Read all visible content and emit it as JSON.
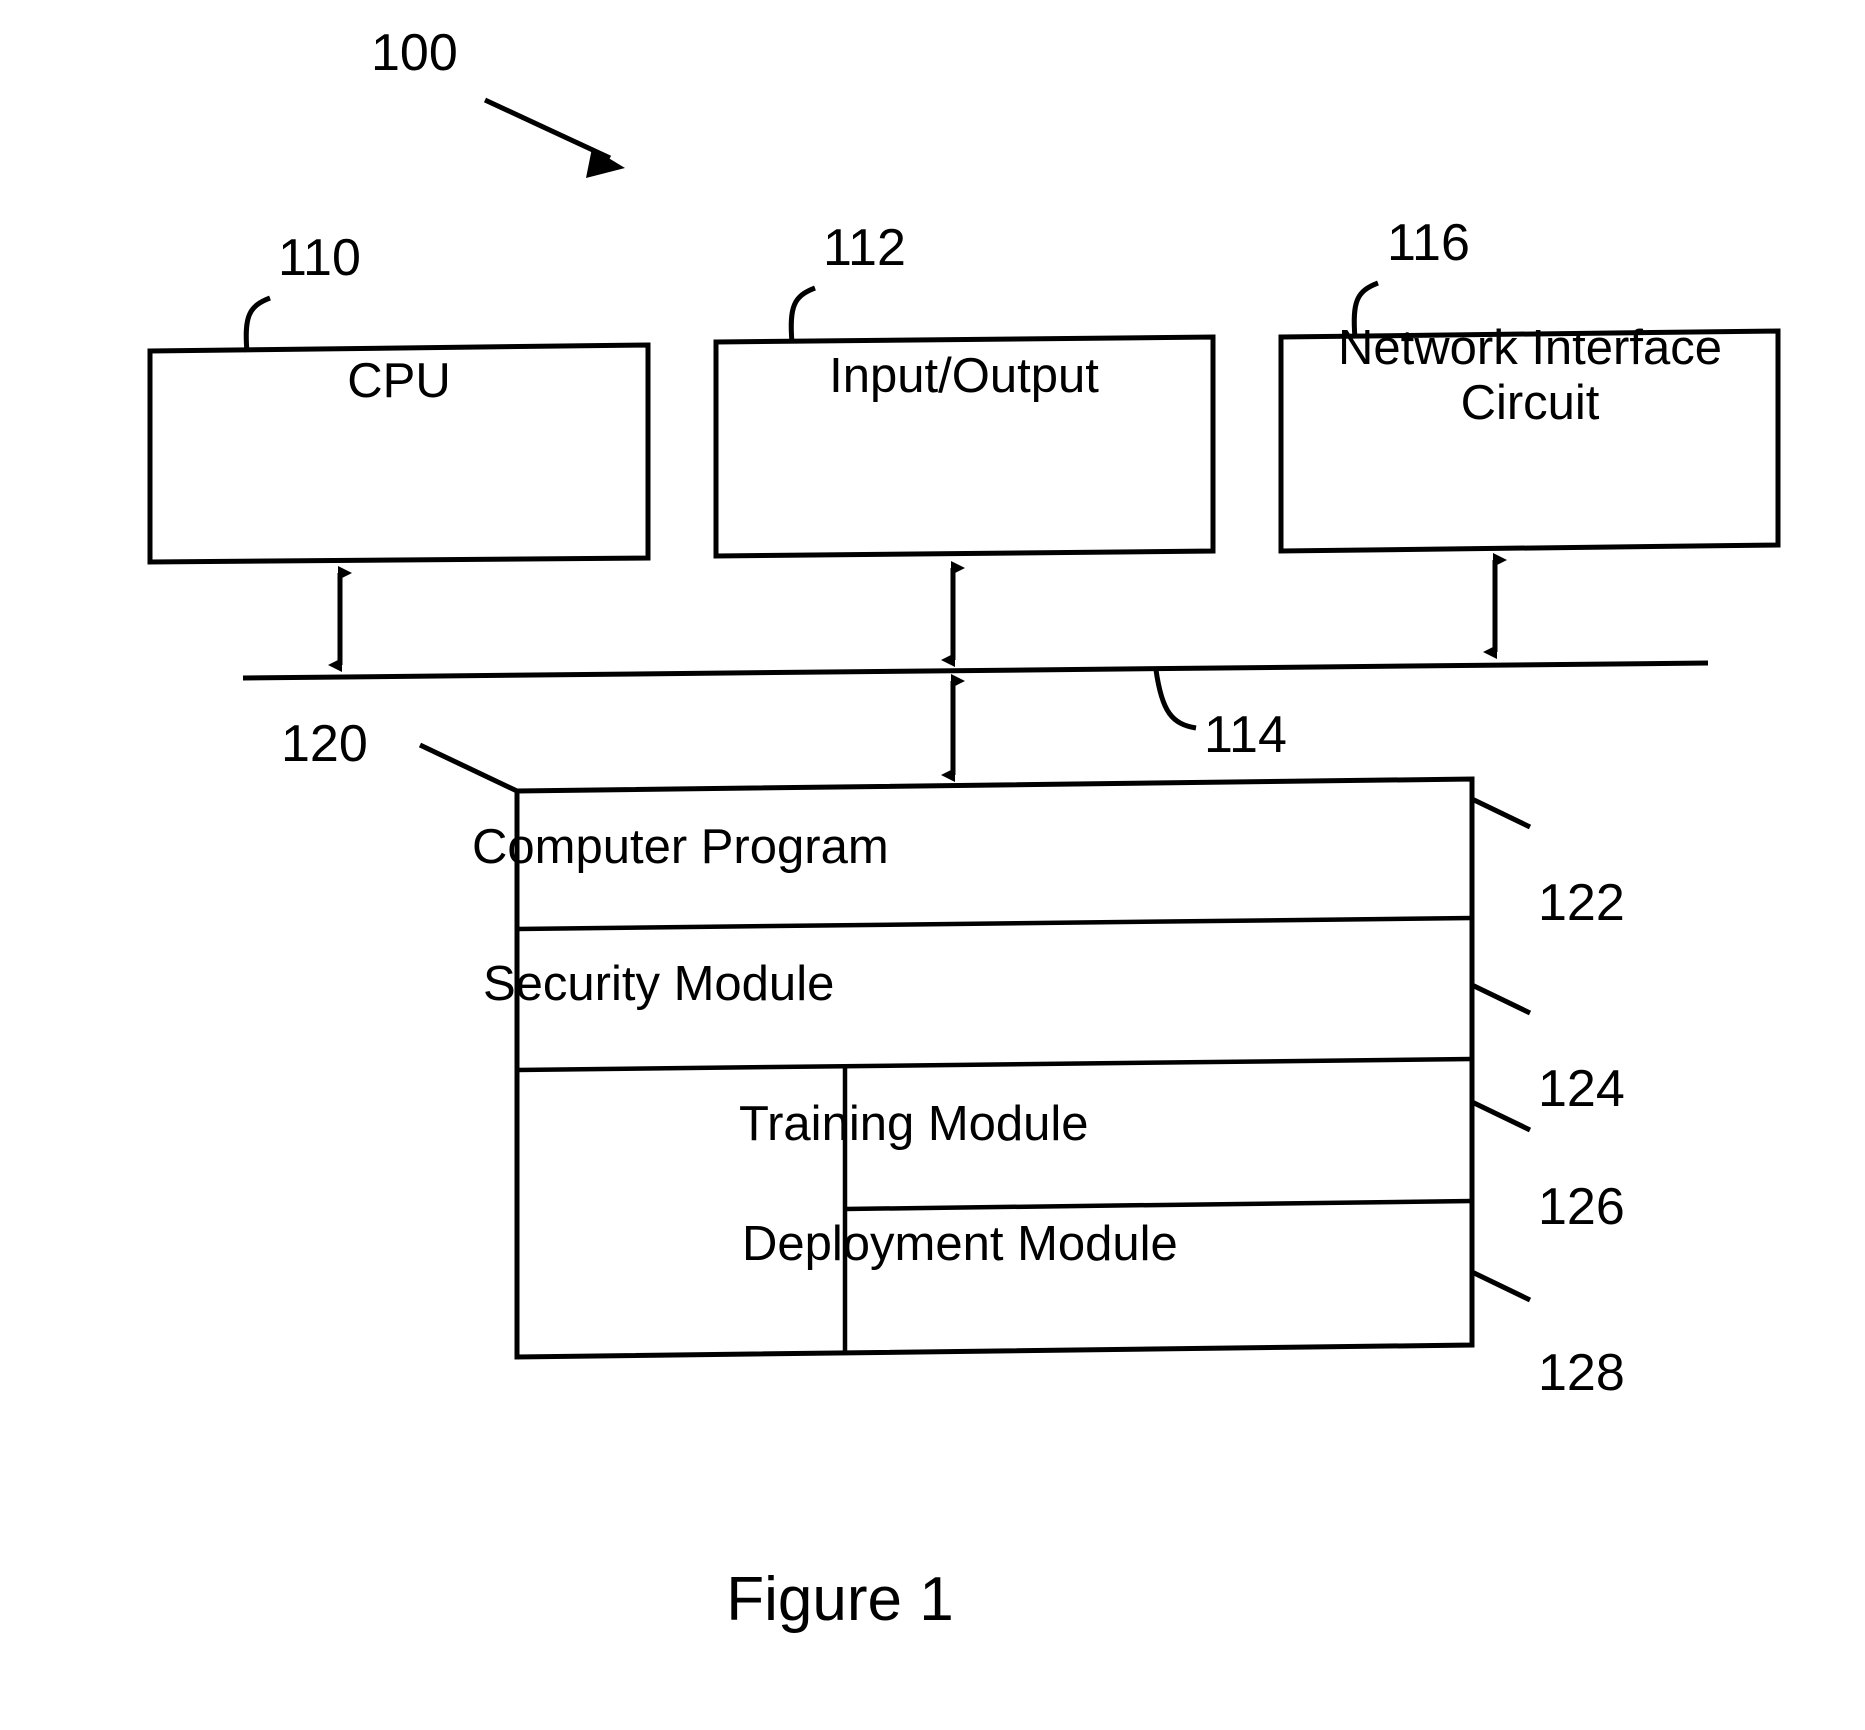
{
  "figure": {
    "caption": "Figure 1",
    "system_ref": "100"
  },
  "top_boxes": [
    {
      "id": "cpu",
      "label": "CPU",
      "ref": "110"
    },
    {
      "id": "io",
      "label": "Input/Output",
      "ref": "112"
    },
    {
      "id": "nic",
      "label": "Network Interface",
      "label2": "Circuit",
      "ref": "116"
    }
  ],
  "bus": {
    "ref": "114",
    "name": "bus-line"
  },
  "memory": {
    "ref": "120",
    "rows": [
      {
        "id": "computer-program",
        "label": "Computer Program",
        "ref": "122"
      },
      {
        "id": "security-module",
        "label": "Security Module",
        "ref": "124"
      },
      {
        "id": "training-module",
        "label": "Training Module",
        "ref": "126"
      },
      {
        "id": "deployment-module",
        "label": "Deployment Module",
        "ref": "128"
      }
    ]
  },
  "colors": {
    "ink": "#000000",
    "paper": "#ffffff"
  }
}
